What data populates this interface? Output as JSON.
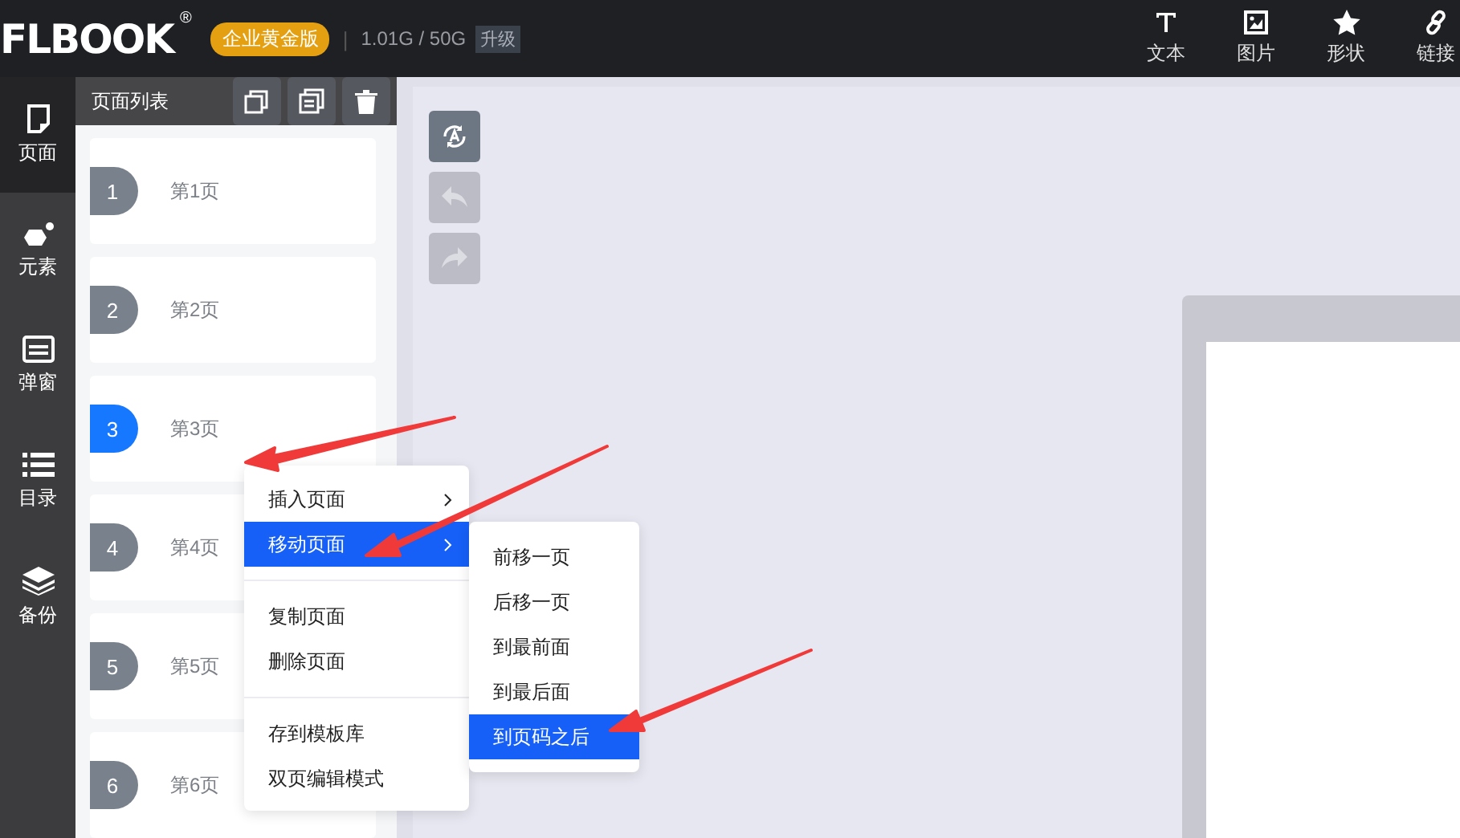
{
  "header": {
    "logo": "FLBOOK",
    "logo_mark": "®",
    "edition_badge": "企业黄金版",
    "separator": "|",
    "storage": "1.01G / 50G",
    "upgrade_button": "升级",
    "tools": [
      {
        "label": "文本",
        "kind": "text"
      },
      {
        "label": "图片",
        "kind": "image"
      },
      {
        "label": "形状",
        "kind": "shape"
      },
      {
        "label": "链接",
        "kind": "link"
      }
    ]
  },
  "rail": [
    {
      "label": "页面",
      "kind": "page",
      "selected": true
    },
    {
      "label": "元素",
      "kind": "element",
      "selected": false
    },
    {
      "label": "弹窗",
      "kind": "popup",
      "selected": false
    },
    {
      "label": "目录",
      "kind": "toc",
      "selected": false
    },
    {
      "label": "备份",
      "kind": "backup",
      "selected": false
    }
  ],
  "page_panel": {
    "title": "页面列表",
    "pages": [
      {
        "number": "1",
        "label": "第1页",
        "selected": false
      },
      {
        "number": "2",
        "label": "第2页",
        "selected": false
      },
      {
        "number": "3",
        "label": "第3页",
        "selected": true
      },
      {
        "number": "4",
        "label": "第4页",
        "selected": false
      },
      {
        "number": "5",
        "label": "第5页",
        "selected": false
      },
      {
        "number": "6",
        "label": "第6页",
        "selected": false
      }
    ]
  },
  "context_menu": {
    "groups": [
      [
        {
          "label": "插入页面",
          "has_submenu": true,
          "selected": false
        },
        {
          "label": "移动页面",
          "has_submenu": true,
          "selected": true
        }
      ],
      [
        {
          "label": "复制页面",
          "has_submenu": false,
          "selected": false
        },
        {
          "label": "删除页面",
          "has_submenu": false,
          "selected": false
        }
      ],
      [
        {
          "label": "存到模板库",
          "has_submenu": false,
          "selected": false
        },
        {
          "label": "双页编辑模式",
          "has_submenu": false,
          "selected": false
        }
      ]
    ],
    "submenu": [
      {
        "label": "前移一页",
        "selected": false
      },
      {
        "label": "后移一页",
        "selected": false
      },
      {
        "label": "到最前面",
        "selected": false
      },
      {
        "label": "到最后面",
        "selected": false
      },
      {
        "label": "到页码之后",
        "selected": true
      }
    ]
  },
  "canvas_tools": [
    {
      "kind": "auto",
      "disabled": false
    },
    {
      "kind": "undo",
      "disabled": true
    },
    {
      "kind": "redo",
      "disabled": true
    }
  ]
}
